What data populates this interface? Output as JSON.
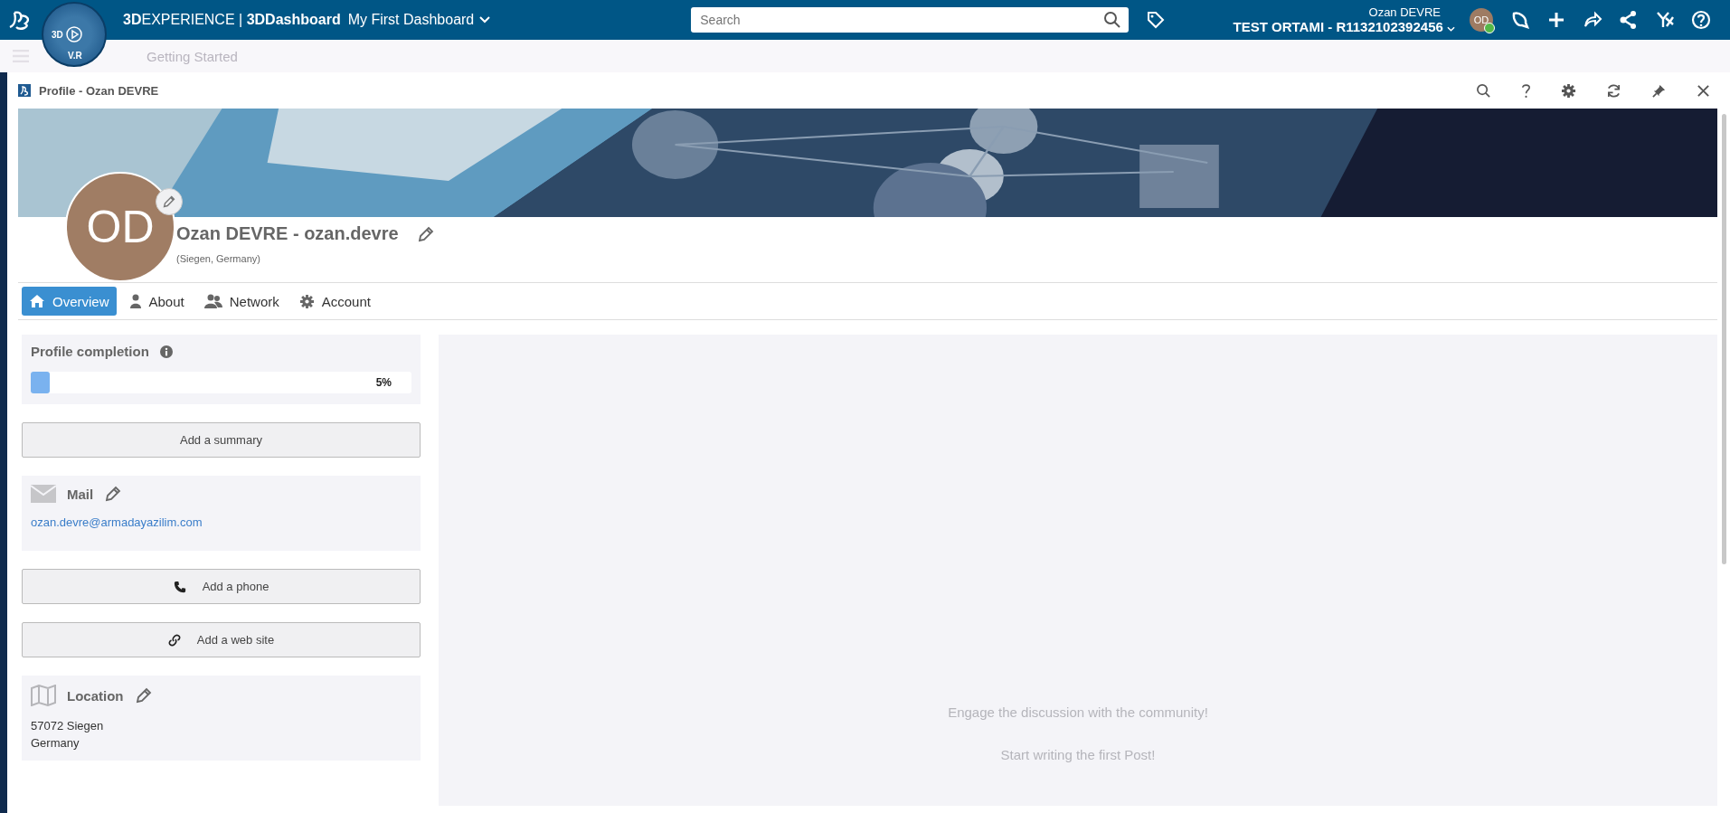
{
  "top_bar": {
    "compass_labels": [
      "3D",
      "V.R"
    ],
    "brand_bold": "3D",
    "brand_rest": "EXPERIENCE",
    "separator": "|",
    "app": "3DDashboard",
    "dashboard": "My First Dashboard",
    "search": {
      "placeholder": "Search"
    },
    "user_name": "Ozan DEVRE",
    "tenant": "TEST ORTAMI - R1132102392456",
    "avatar_initials": "OD",
    "online": true
  },
  "dashboard_tabs": [
    {
      "label": "Getting Started"
    }
  ],
  "widget": {
    "title": "Profile - Ozan DEVRE"
  },
  "profile": {
    "initials": "OD",
    "name": "Ozan DEVRE - ozan.devre",
    "location": "(Siegen, Germany)"
  },
  "tabs": [
    {
      "label": "Overview",
      "selected": true
    },
    {
      "label": "About",
      "selected": false
    },
    {
      "label": "Network",
      "selected": false
    },
    {
      "label": "Account",
      "selected": false
    }
  ],
  "completion": {
    "title": "Profile completion",
    "level": 0.05,
    "reading": "5%"
  },
  "summary_button": "Add a summary",
  "mail": {
    "title": "Mail",
    "email": "ozan.devre@armadayazilim.com"
  },
  "phone_button": "Add a phone",
  "web_button": "Add a web site",
  "location": {
    "title": "Location",
    "lines": [
      "57072 Siegen",
      "Germany"
    ]
  },
  "feed": {
    "message": "Engage the discussion with the community!",
    "hint": "Start writing the first Post!"
  }
}
